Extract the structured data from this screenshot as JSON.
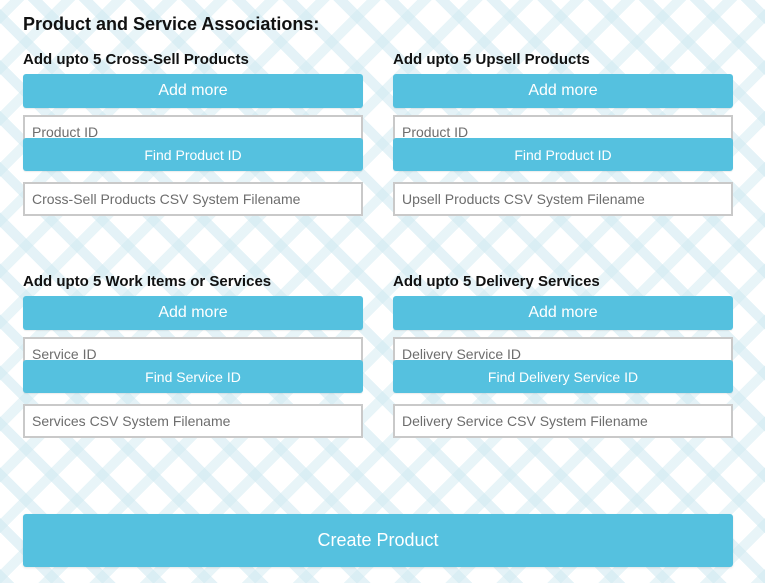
{
  "page": {
    "heading": "Product and Service Associations:"
  },
  "cross_sell": {
    "title": "Add upto 5 Cross-Sell Products",
    "add_label": "Add more",
    "id_placeholder": "Product ID",
    "find_label": "Find Product ID",
    "csv_placeholder": "Cross-Sell Products CSV System Filename"
  },
  "upsell": {
    "title": "Add upto 5 Upsell Products",
    "add_label": "Add more",
    "id_placeholder": "Product ID",
    "find_label": "Find Product ID",
    "csv_placeholder": "Upsell Products CSV System Filename"
  },
  "services": {
    "title": "Add upto 5 Work Items or Services",
    "add_label": "Add more",
    "id_placeholder": "Service ID",
    "find_label": "Find Service ID",
    "csv_placeholder": "Services CSV System Filename"
  },
  "delivery": {
    "title": "Add upto 5 Delivery Services",
    "add_label": "Add more",
    "id_placeholder": "Delivery Service ID",
    "find_label": "Find Delivery Service ID",
    "csv_placeholder": "Delivery Service CSV System Filename"
  },
  "footer": {
    "create_label": "Create Product"
  },
  "colors": {
    "accent": "#55c1df",
    "background_pattern": "#cde8f0"
  }
}
